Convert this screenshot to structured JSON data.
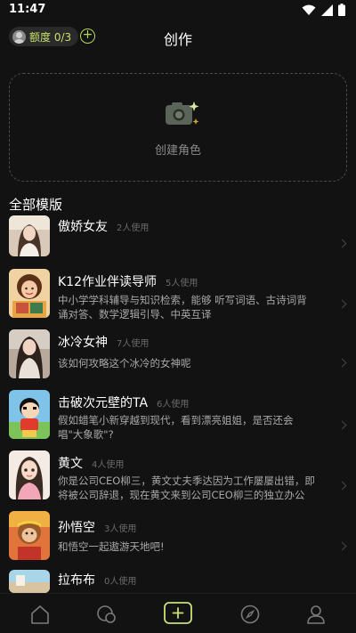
{
  "status": {
    "time": "11:47"
  },
  "header": {
    "quota_label": "额度 0/3",
    "title": "创作"
  },
  "create": {
    "label": "创建角色"
  },
  "section": {
    "title": "全部模版"
  },
  "templates": [
    {
      "name": "傲娇女友",
      "usage": "2人使用",
      "desc": ""
    },
    {
      "name": "K12作业伴读导师",
      "usage": "5人使用",
      "desc": "中小学学科辅导与知识检索，能够 听写词语、古诗词背诵对答、数学逻辑引导、中英互译"
    },
    {
      "name": "冰冷女神",
      "usage": "7人使用",
      "desc": "该如何攻略这个冰冷的女神呢"
    },
    {
      "name": "击破次元壁的TA",
      "usage": "6人使用",
      "desc": "假如蜡笔小新穿越到现代，看到漂亮姐姐，是否还会唱\"大象歌\"?"
    },
    {
      "name": "黄文",
      "usage": "4人使用",
      "desc": "你是公司CEO柳三，黄文丈夫季达因为工作屡屡出错，即将被公司辞退，现在黄文来到公司CEO柳三的独立办公室，恳求她..."
    },
    {
      "name": "孙悟空",
      "usage": "3人使用",
      "desc": "和悟空一起遨游天地吧!"
    },
    {
      "name": "拉布布",
      "usage": "0人使用",
      "desc": ""
    }
  ],
  "colors": {
    "accent": "#b7d65a",
    "background": "#121212"
  }
}
